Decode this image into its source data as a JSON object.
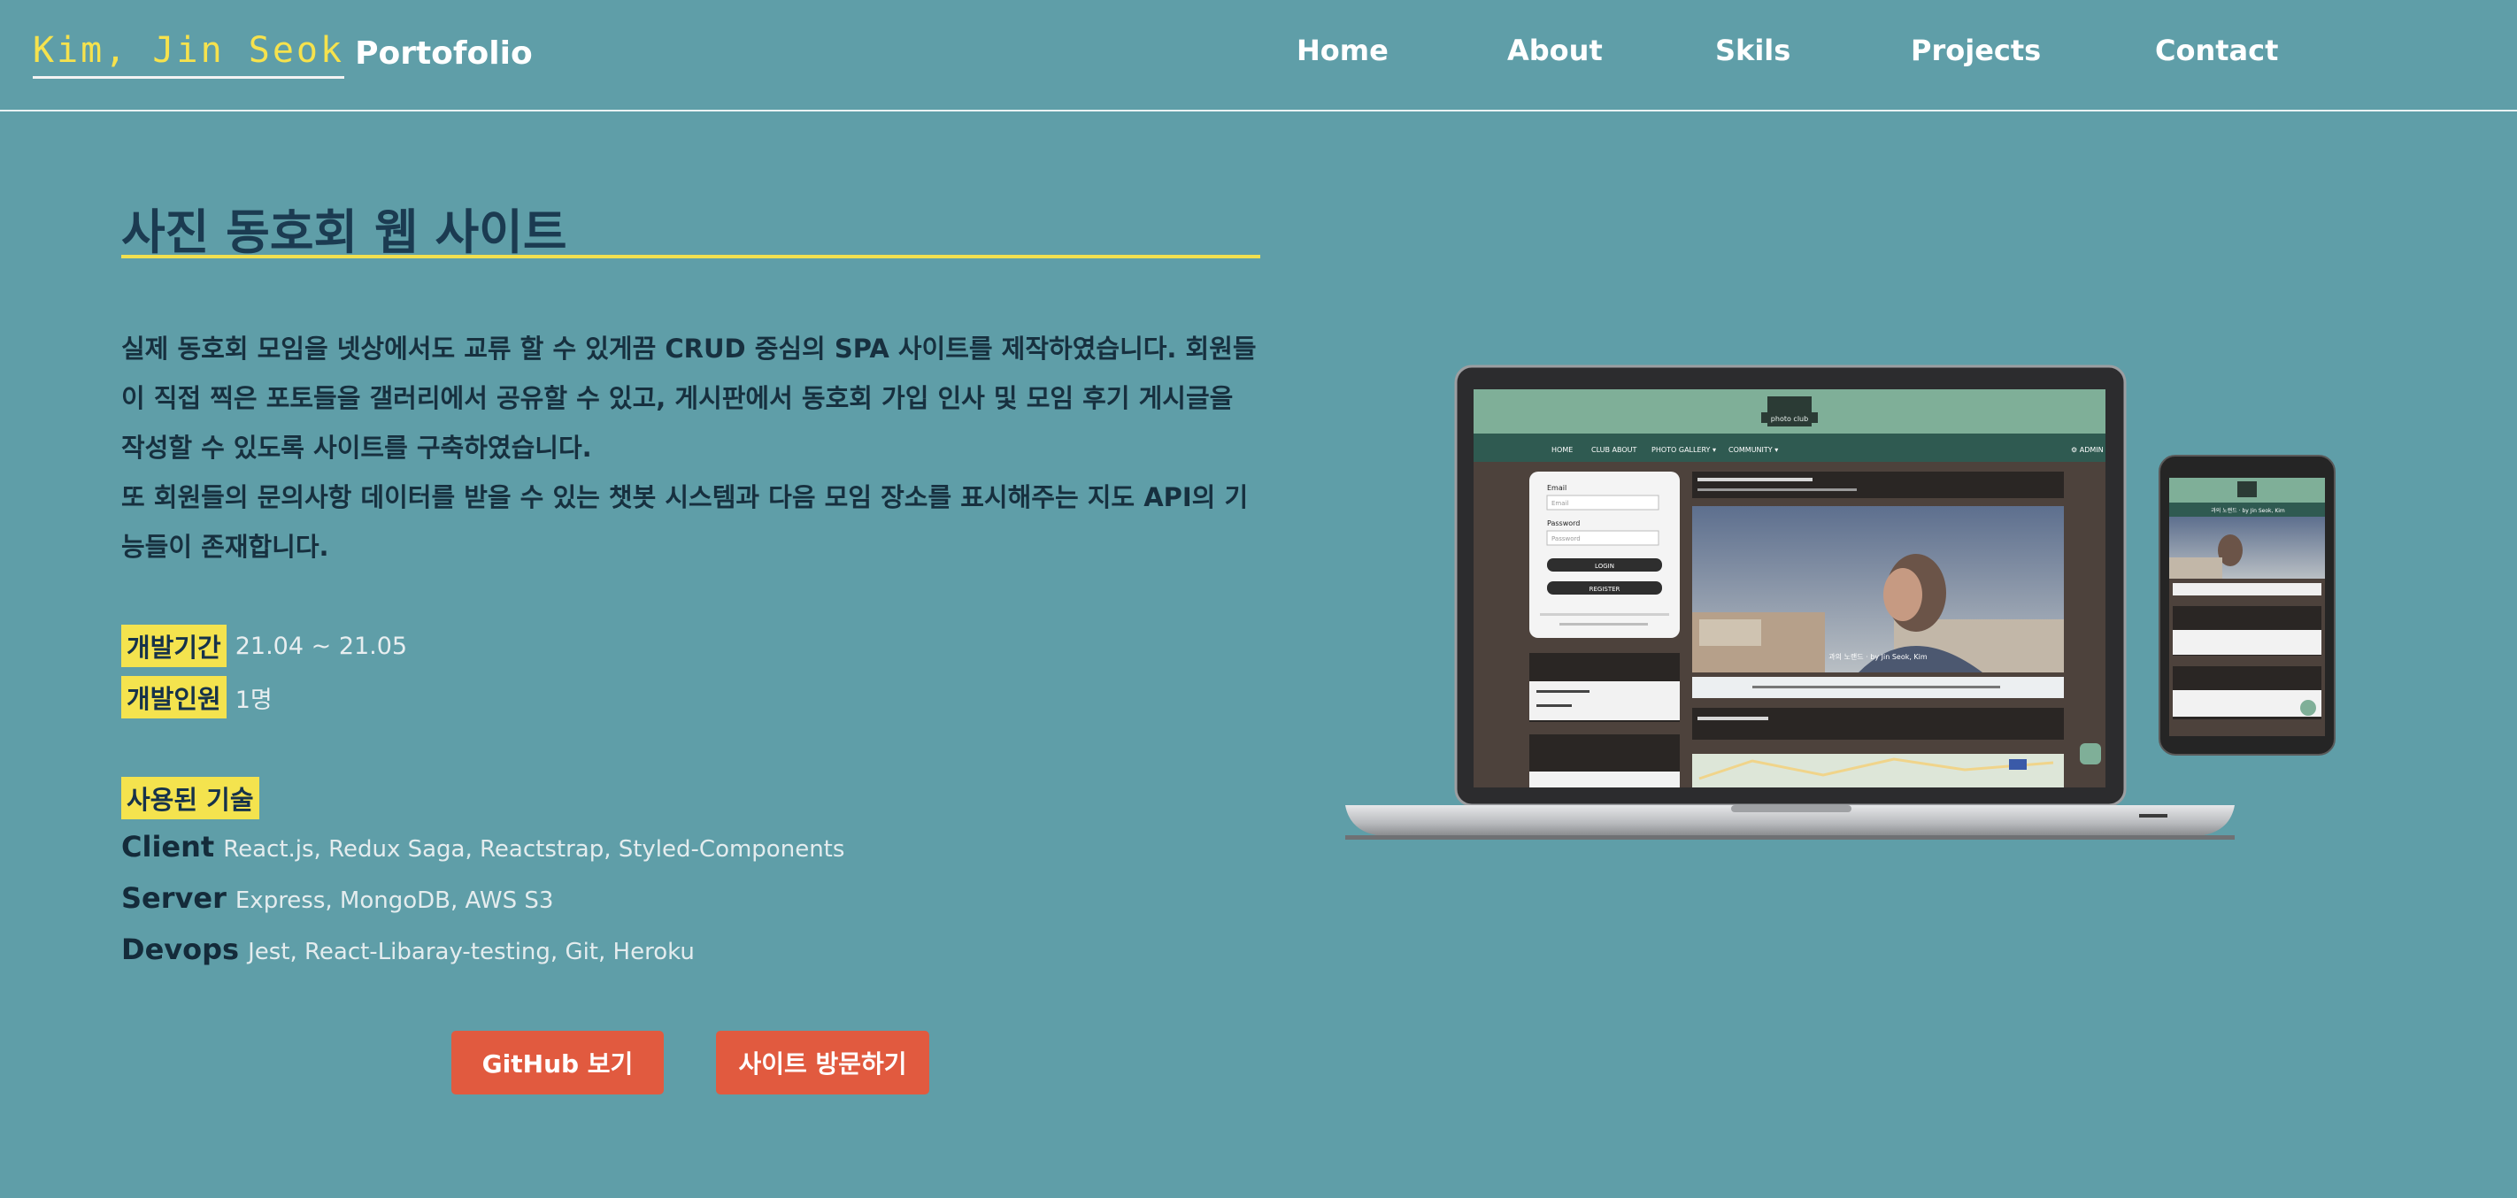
{
  "header": {
    "brand_name": "Kim, Jin Seok",
    "brand_suffix": "Portofolio",
    "nav": [
      "Home",
      "About",
      "Skils",
      "Projects",
      "Contact"
    ]
  },
  "project": {
    "title": "사진 동호회 웹 사이트",
    "description_p1": "실제 동호회 모임을 넷상에서도 교류 할 수 있게끔 CRUD 중심의 SPA 사이트를 제작하였습니다. 회원들이 직접 찍은 포토들을 갤러리에서 공유할 수 있고, 게시판에서 동호회 가입 인사 및 모임 후기 게시글을 작성할 수 있도록 사이트를 구축하였습니다.",
    "description_p2": "또 회원들의 문의사항 데이터를 받을 수 있는 챗봇 시스템과 다음 모임 장소를 표시해주는 지도 API의 기능들이 존재합니다.",
    "period_label": "개발기간",
    "period_value": "21.04 ~ 21.05",
    "members_label": "개발인원",
    "members_value": "1명",
    "tech_label": "사용된 기술",
    "tech": [
      {
        "label": "Client",
        "value": "React.js, Redux Saga, Reactstrap, Styled-Components"
      },
      {
        "label": "Server",
        "value": "Express, MongoDB, AWS S3"
      },
      {
        "label": "Devops",
        "value": "Jest, React-Libaray-testing, Git, Heroku"
      }
    ],
    "github_button": "GitHub 보기",
    "visit_button": "사이트 방문하기"
  },
  "mockup": {
    "site_logo": "photo club",
    "menu": [
      "HOME",
      "CLUB ABOUT",
      "PHOTO GALLERY ▾",
      "COMMUNITY ▾"
    ],
    "admin": "⚙ ADMIN",
    "login": {
      "email_label": "Email",
      "email_placeholder": "Email",
      "password_label": "Password",
      "password_placeholder": "Password",
      "login_btn": "LOGIN",
      "register_btn": "REGISTER"
    },
    "caption": "과의 노랜드 · by Jin Seok, Kim",
    "mobile_caption": "과의 노랜드  ·  by Jin Seok, Kim"
  },
  "colors": {
    "background": "#5f9ea8",
    "accent_yellow": "#f4e34e",
    "button": "#e15a3f",
    "title": "#1b3b51"
  }
}
